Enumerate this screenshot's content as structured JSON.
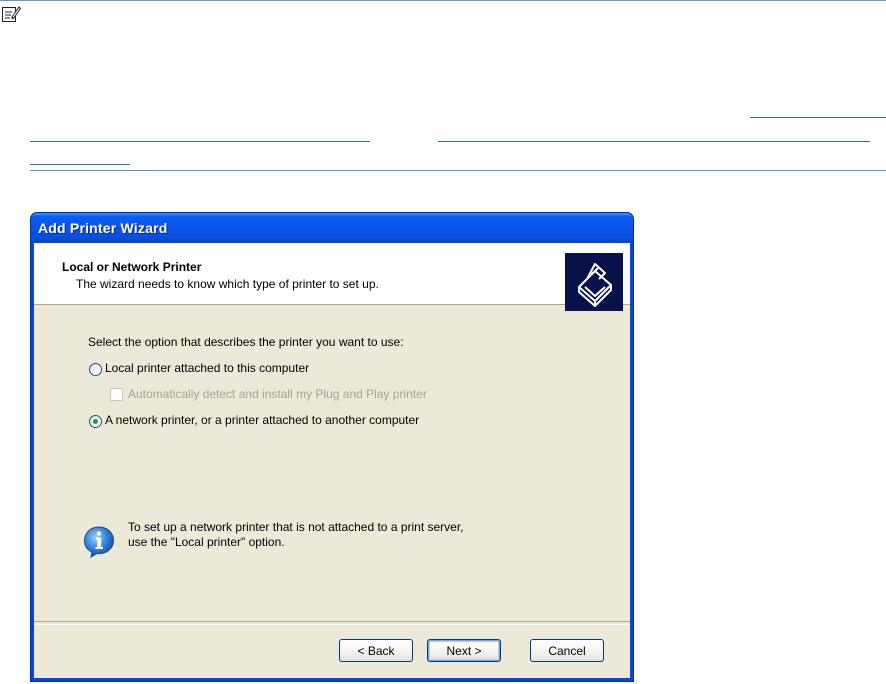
{
  "window": {
    "title": "Add Printer Wizard"
  },
  "header": {
    "title": "Local or Network Printer",
    "subtitle": "The wizard needs to know which type of printer to set up."
  },
  "body": {
    "prompt": "Select the option that describes the printer you want to use:",
    "options": [
      {
        "label": "Local printer attached to this computer",
        "selected": false
      },
      {
        "label": "A network printer, or a printer attached to another computer",
        "selected": true
      }
    ],
    "auto_detect": {
      "label": "Automatically detect and install my Plug and Play printer",
      "checked": false,
      "enabled": false
    },
    "info": {
      "line1": "To set up a network printer that is not attached to a print server,",
      "line2": "use the \"Local printer\" option."
    }
  },
  "buttons": {
    "back": "< Back",
    "next": "Next >",
    "cancel": "Cancel"
  },
  "icons": {
    "note": "note-pencil-icon",
    "header": "printer-icon",
    "info": "info-icon"
  },
  "colors": {
    "titlebar": "#0a55e8",
    "client": "#ece9d8",
    "link_rule": "#5b9bd5",
    "radio_dot": "#21a121"
  }
}
